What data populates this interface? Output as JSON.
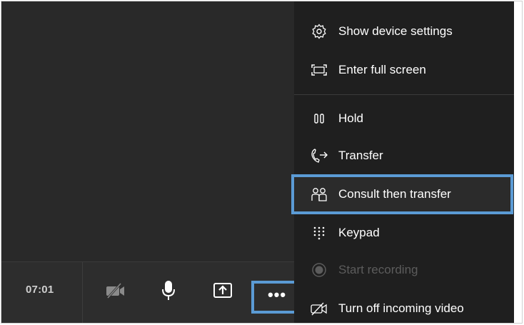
{
  "call": {
    "timer": "07:01"
  },
  "controls": {
    "camera": {
      "icon": "camera-off-icon"
    },
    "mic": {
      "icon": "microphone-icon"
    },
    "share": {
      "icon": "share-screen-icon"
    },
    "more": {
      "label": "•••",
      "icon": "more-options-icon"
    }
  },
  "menu": {
    "items": [
      {
        "label": "Show device settings",
        "icon": "gear-icon",
        "enabled": true
      },
      {
        "label": "Enter full screen",
        "icon": "fullscreen-icon",
        "enabled": true
      },
      {
        "label": "Hold",
        "icon": "pause-icon",
        "enabled": true
      },
      {
        "label": "Transfer",
        "icon": "phone-transfer-icon",
        "enabled": true
      },
      {
        "label": "Consult then transfer",
        "icon": "people-consult-icon",
        "enabled": true,
        "highlighted": true
      },
      {
        "label": "Keypad",
        "icon": "dialpad-icon",
        "enabled": true
      },
      {
        "label": "Start recording",
        "icon": "record-icon",
        "enabled": false
      },
      {
        "label": "Turn off incoming video",
        "icon": "video-off-icon",
        "enabled": true
      }
    ]
  },
  "colors": {
    "highlight_outline": "#5b9bd5",
    "menu_bg": "#1f1f1f",
    "call_bg": "#292929",
    "text": "#ffffff",
    "disabled_text": "#5c5c5c"
  }
}
